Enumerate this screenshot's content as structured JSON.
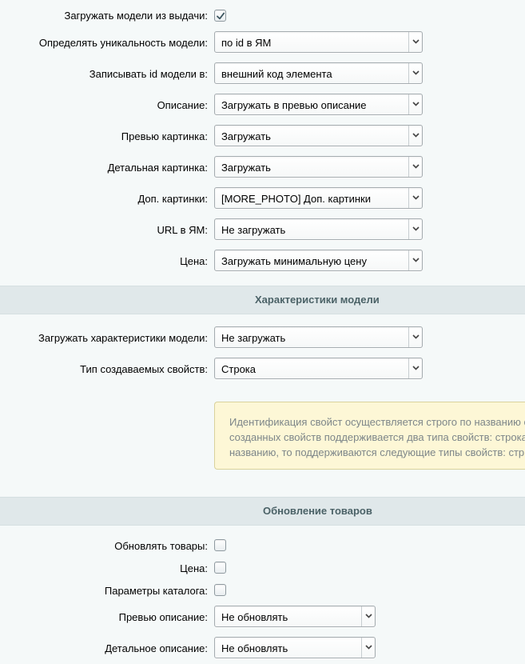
{
  "load": {
    "models_from_results": {
      "label": "Загружать модели из выдачи:",
      "checked": true
    },
    "uniqueness": {
      "label": "Определять уникальность модели:",
      "value": "по id в ЯМ"
    },
    "write_model_id": {
      "label": "Записывать id модели в:",
      "value": "внешний код элемента"
    },
    "description": {
      "label": "Описание:",
      "value": "Загружать в превью описание"
    },
    "preview_image": {
      "label": "Превью картинка:",
      "value": "Загружать"
    },
    "detail_image": {
      "label": "Детальная картинка:",
      "value": "Загружать"
    },
    "more_images": {
      "label": "Доп. картинки:",
      "value": "[MORE_PHOTO] Доп. картинки"
    },
    "url": {
      "label": "URL в ЯМ:",
      "value": "Не загружать"
    },
    "price": {
      "label": "Цена:",
      "value": "Загружать минимальную цену"
    }
  },
  "model_properties": {
    "title": "Характеристики модели",
    "load_properties": {
      "label": "Загружать характеристики модели:",
      "value": "Не загружать"
    },
    "property_type": {
      "label": "Тип создаваемых свойств:",
      "value": "Строка"
    },
    "note": {
      "line1": "Идентификация свойст осуществляется строго по названию с",
      "line2": "созданных свойств поддерживается два типа свойств: строка",
      "line3": "названию, то поддерживаются следующие типы свойств: стр"
    }
  },
  "update_products": {
    "title": "Обновление товаров",
    "update_items": {
      "label": "Обновлять товары:",
      "checked": false
    },
    "price": {
      "label": "Цена:",
      "checked": false
    },
    "catalog_params": {
      "label": "Параметры каталога:",
      "checked": false
    },
    "preview_description": {
      "label": "Превью описание:",
      "value": "Не обновлять"
    },
    "detail_description": {
      "label": "Детальное описание:",
      "value": "Не обновлять"
    }
  },
  "icons": {
    "select_arrow": "chevron-down-icon",
    "check": "checkmark-icon"
  },
  "colors": {
    "background": "#f5f9f9",
    "section_header_bg": "#e0e8ea",
    "section_header_text": "#4b6267",
    "note_bg": "#fdf7d6",
    "note_border": "#d9d29c",
    "note_text": "#7d8689"
  }
}
